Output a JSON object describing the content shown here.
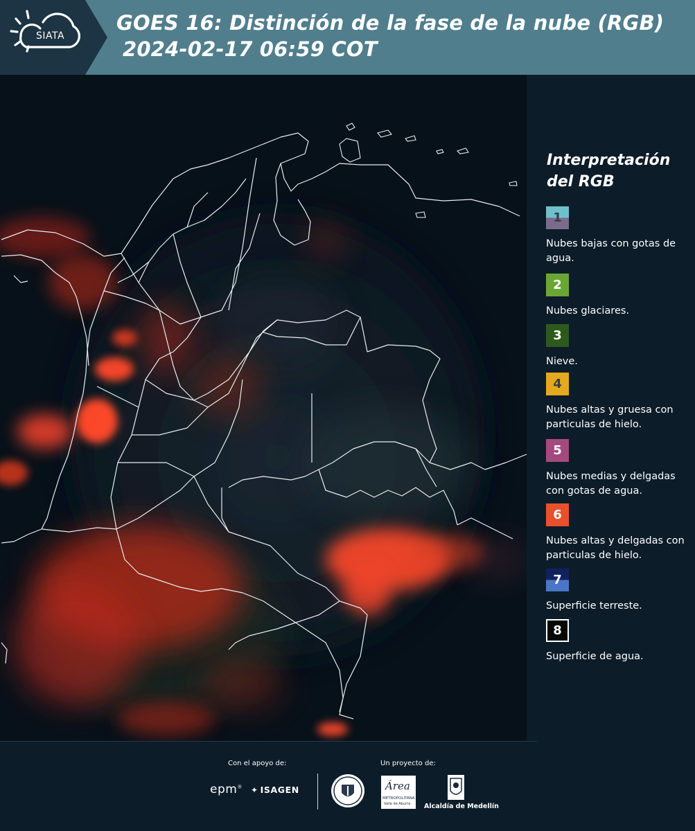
{
  "header": {
    "logo_text": "SIATA",
    "title_line1": "GOES 16: Distinción de la fase de la nube (RGB)",
    "title_line2": "2024-02-17 06:59 COT",
    "colors": {
      "left": "#1c3443",
      "right": "#507e8c"
    }
  },
  "legend": {
    "title": "Interpretación del RGB",
    "items": [
      {
        "number": "1",
        "label": "Nubes bajas con gotas de agua.",
        "top_color": "#6ec0cc",
        "bottom_color": "#7b6b8a",
        "text_color": "#3b3b4a"
      },
      {
        "number": "2",
        "label": "Nubes glaciares.",
        "top_color": "#6aa636",
        "bottom_color": "#6aa636",
        "text_color": "#ffffff"
      },
      {
        "number": "3",
        "label": "Nieve.",
        "top_color": "#2d5a1c",
        "bottom_color": "#2d5a1c",
        "text_color": "#ffffff"
      },
      {
        "number": "4",
        "label": "Nubes altas y gruesa con particulas de hielo.",
        "top_color": "#e2aa1c",
        "bottom_color": "#e2aa1c",
        "text_color": "#3b3b4a"
      },
      {
        "number": "5",
        "label": "Nubes medias y delgadas con gotas de agua.",
        "top_color": "#a24a7e",
        "bottom_color": "#a24a7e",
        "text_color": "#ffffff"
      },
      {
        "number": "6",
        "label": "Nubes altas y delgadas con particulas de hielo.",
        "top_color": "#e8502e",
        "bottom_color": "#e8502e",
        "text_color": "#ffffff"
      },
      {
        "number": "7",
        "label": "Superficie terreste.",
        "top_color": "#12215e",
        "bottom_color": "#4a76c8",
        "text_color": "#ffffff"
      },
      {
        "number": "8",
        "label": "Superficie de agua.",
        "top_color": "#050a06",
        "bottom_color": "#050a06",
        "text_color": "#ffffff"
      }
    ]
  },
  "footer": {
    "support_label": "Con el apoyo de:",
    "project_label": "Un proyecto de:",
    "epm": "epm",
    "isagen": "ISAGEN",
    "metro_name": "Área",
    "metro_sub1": "METROPOLITANA",
    "metro_sub2": "Valle de Aburrá",
    "alcaldia": "Alcaldía de Medellín"
  }
}
